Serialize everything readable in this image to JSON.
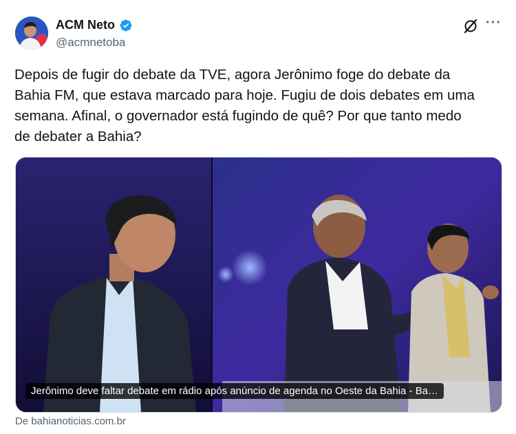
{
  "author": {
    "display_name": "ACM Neto",
    "handle": "@acmnetoba",
    "verified": true
  },
  "icons": {
    "avatar": "profile-photo",
    "verified": "verified-badge-icon",
    "grok": "grok-icon",
    "more": "more-options-icon"
  },
  "tweet": {
    "text": "Depois de fugir do debate da TVE, agora Jerônimo foge do debate da\nBahia FM, que estava marcado para hoje. Fugiu de dois debates em uma\nsemana. Afinal, o governador está fugindo de quê? Por que tanto medo\nde debater a Bahia?"
  },
  "link_card": {
    "caption": "Jerônimo deve faltar debate em rádio após anúncio de agenda no Oeste da Bahia - Ba…",
    "source": "De bahianoticias.com.br"
  },
  "colors": {
    "text_primary": "#0f1419",
    "text_secondary": "#536471",
    "verified_blue": "#1d9bf0",
    "border": "#cfd9de"
  }
}
